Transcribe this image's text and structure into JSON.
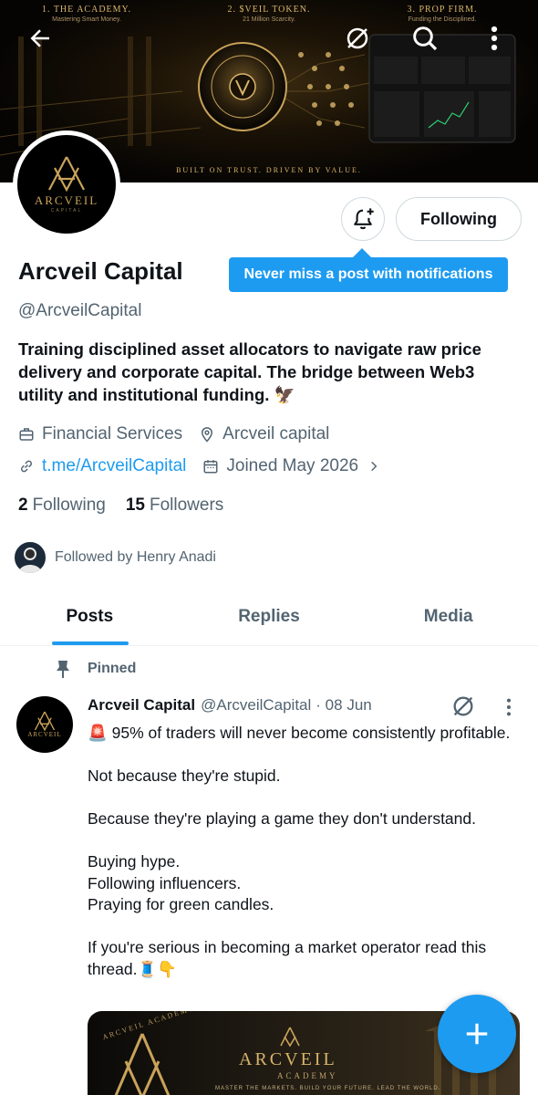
{
  "banner": {
    "columns": [
      {
        "title": "1. THE ACADEMY.",
        "subtitle": "Mastering Smart Money."
      },
      {
        "title": "2. $VEIL TOKEN.",
        "subtitle": "21 Million Scarcity."
      },
      {
        "title": "3. PROP FIRM.",
        "subtitle": "Funding the Disciplined."
      }
    ],
    "tagline": "BUILT ON TRUST. DRIVEN BY VALUE.",
    "accent": "#d9b56a"
  },
  "header": {
    "back_icon": "arrow-left-icon",
    "grok_icon": "grok-icon",
    "search_icon": "search-icon",
    "more_icon": "more-vertical-icon"
  },
  "profile": {
    "avatar_word": "ARCVEIL",
    "avatar_sub": "CAPITAL",
    "display_name": "Arcveil Capital",
    "handle": "@ArcveilCapital",
    "bio": "Training disciplined asset allocators to navigate raw price delivery and corporate capital. The bridge between Web3 utility and institutional funding. 🦅",
    "category": "Financial Services",
    "location": "Arcveil capital",
    "link": "t.me/ArcveilCapital",
    "joined": "Joined May 2026",
    "following_count": "2",
    "following_label": "Following",
    "followers_count": "15",
    "followers_label": "Followers",
    "followed_by": "Followed by Henry Anadi"
  },
  "actions": {
    "follow_label": "Following",
    "tooltip": "Never miss a post with notifications",
    "accent": "#1d9bf0"
  },
  "tabs": [
    {
      "label": "Posts",
      "active": true
    },
    {
      "label": "Replies",
      "active": false
    },
    {
      "label": "Media",
      "active": false
    }
  ],
  "post": {
    "pinned_label": "Pinned",
    "name": "Arcveil Capital",
    "handle": "@ArcveilCapital",
    "date": "· 08 Jun",
    "body": "🚨 95% of traders will never become consistently profitable.\n\nNot because they're stupid.\n\nBecause they're playing a game they don't understand.\n\nBuying hype.\nFollowing influencers.\nPraying for green candles.\n\nIf you're serious in becoming a market operator read this thread.🧵👇",
    "media": {
      "arc_text": "ARCVEIL ACADEMY",
      "title": "ARCVEIL",
      "subtitle": "ACADEMY",
      "tagline": "MASTER THE MARKETS. BUILD YOUR FUTURE. LEAD THE WORLD."
    }
  },
  "fab": {
    "icon": "plus-icon"
  }
}
